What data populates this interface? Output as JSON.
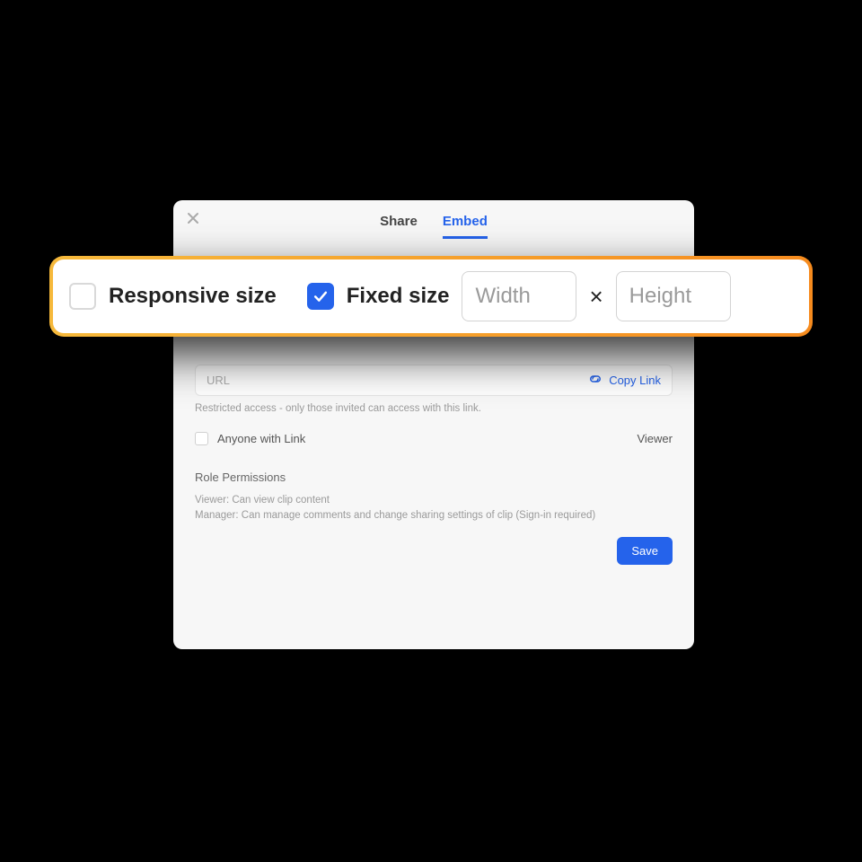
{
  "modal": {
    "tabs": {
      "share": "Share",
      "embed": "Embed"
    }
  },
  "sizebar": {
    "responsive_label": "Responsive size",
    "fixed_label": "Fixed size",
    "width_placeholder": "Width",
    "height_placeholder": "Height",
    "times": "×"
  },
  "url": {
    "placeholder": "URL",
    "copy_label": "Copy Link",
    "restricted_hint": "Restricted access - only those invited can access with this link."
  },
  "access": {
    "anyone_label": "Anyone with Link",
    "role": "Viewer"
  },
  "permissions": {
    "title": "Role Permissions",
    "viewer_line": "Viewer: Can view clip content",
    "manager_line": "Manager: Can manage comments and change sharing settings of clip (Sign-in required)"
  },
  "buttons": {
    "save": "Save"
  }
}
